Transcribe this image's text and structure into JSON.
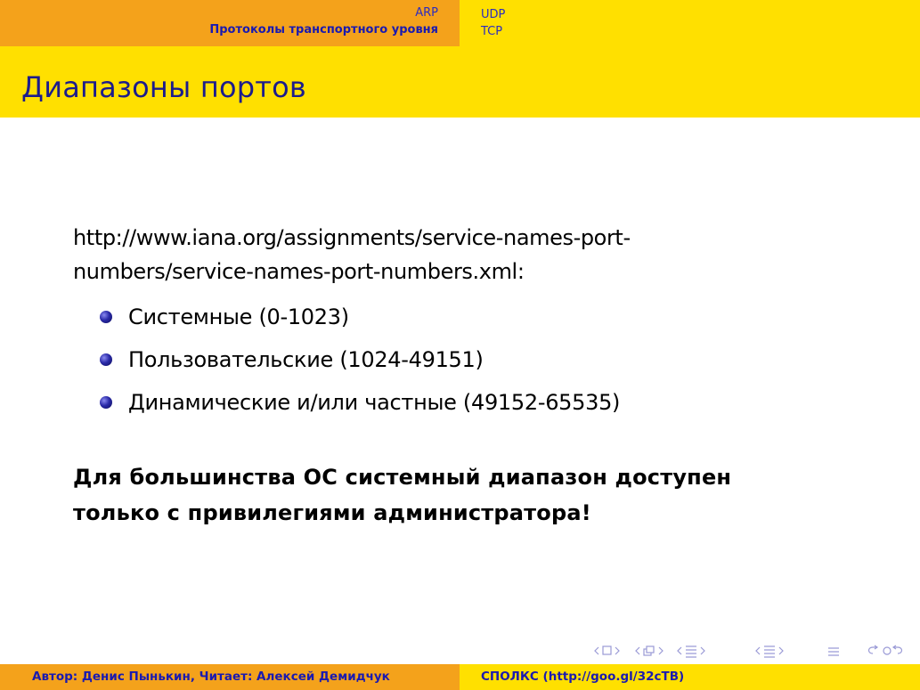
{
  "header": {
    "section": "ARP",
    "subsection": "Протоколы транспортного уровня",
    "items": [
      "UDP",
      "TCP"
    ]
  },
  "frame": {
    "title": "Диапазоны портов"
  },
  "content": {
    "url_line1": "http://www.iana.org/assignments/service-names-port-",
    "url_line2": "numbers/service-names-port-numbers.xml:",
    "bullets": [
      {
        "label": "Системные (0-1023)"
      },
      {
        "label": "Пользовательские (1024-49151)"
      },
      {
        "label": "Динамические и/или частные (49152-65535)"
      }
    ],
    "warning_line1": "Для большинства ОС системный диапазон доступен",
    "warning_line2": "только с привилегиями администратора!"
  },
  "navigation": {
    "icons": [
      "nav-frame-icon",
      "nav-subsection-icon",
      "nav-section-icon",
      "nav-doc-icon",
      "nav-align-icon",
      "nav-search-icon"
    ]
  },
  "footer": {
    "author": "Автор: Денис Пынькин, Читает: Алексей Демидчук",
    "title": "СПОЛКС (http://goo.gl/32cTB)"
  },
  "colors": {
    "orange": "#f4a21b",
    "yellow": "#ffe000",
    "title_blue": "#1c1c8c",
    "nav_blue": "#2c2cbf"
  }
}
